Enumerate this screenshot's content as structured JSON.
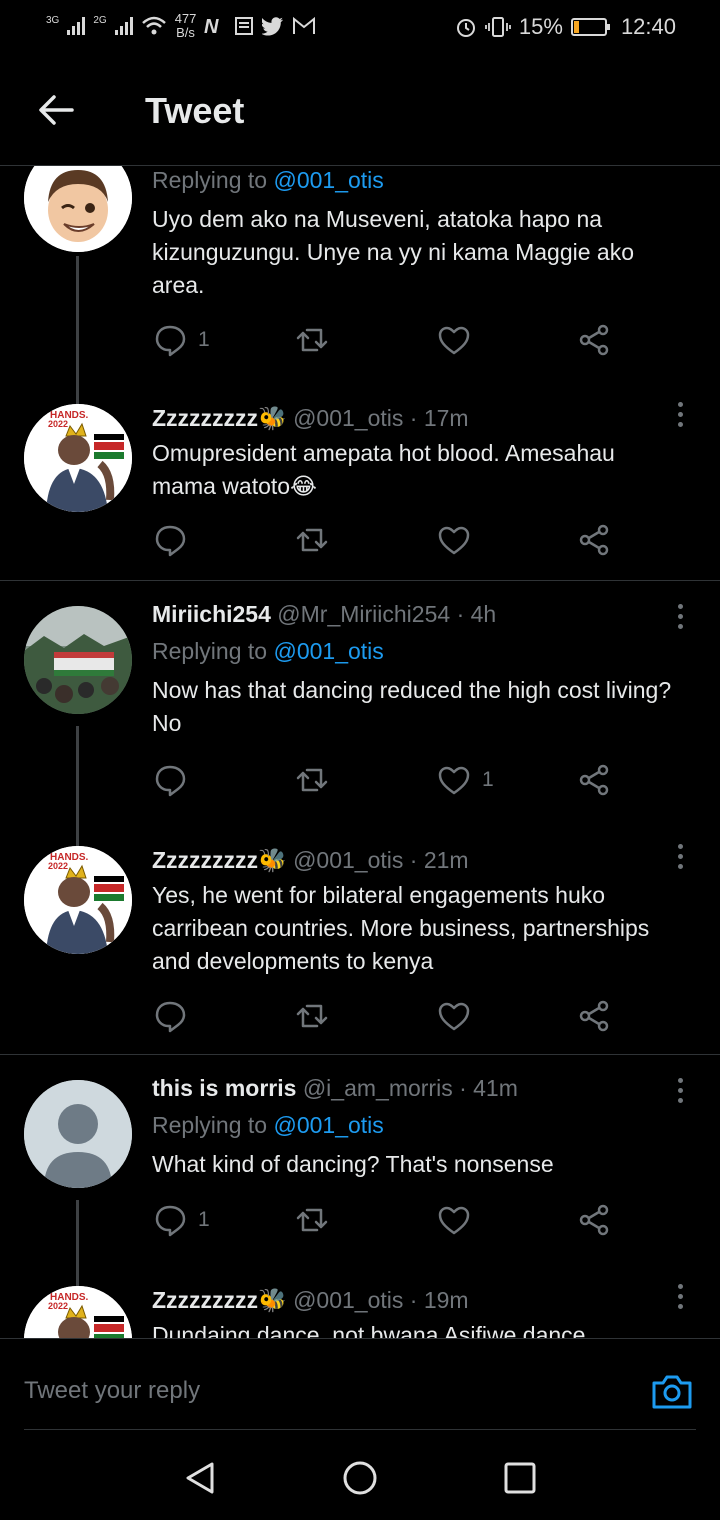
{
  "status": {
    "net1": "3G",
    "net2": "2G",
    "speed_value": "477",
    "speed_unit": "B/s",
    "battery_pct": "15%",
    "battery_level": 0.15,
    "time": "12:40"
  },
  "header": {
    "title": "Tweet"
  },
  "tweets": [
    {
      "name": "",
      "handle": "",
      "time": "",
      "replying_label": "Replying to",
      "replying_handle": "@001_otis",
      "content": "Uyo dem ako na Museveni, atatoka hapo na kizunguzungu. Unye na yy ni kama Maggie ako area.",
      "reply_count": "1",
      "like_count": ""
    },
    {
      "name": "Zzzzzzzzz🐝",
      "handle": "@001_otis",
      "time": "· 17m",
      "content": "Omupresident amepata hot blood. Amesahau mama watoto😂",
      "reply_count": "",
      "like_count": ""
    },
    {
      "name": "Miriichi254",
      "handle": "@Mr_Miriichi254",
      "time": "· 4h",
      "replying_label": "Replying to",
      "replying_handle": "@001_otis",
      "content": "Now has that dancing reduced the high cost living? No",
      "reply_count": "",
      "like_count": "1"
    },
    {
      "name": "Zzzzzzzzz🐝",
      "handle": "@001_otis",
      "time": "· 21m",
      "content": "Yes, he went for bilateral engagements huko carribean countries. More business, partnerships and developments to kenya",
      "reply_count": "",
      "like_count": ""
    },
    {
      "name": "this is morris",
      "handle": "@i_am_morris",
      "time": "· 41m",
      "replying_label": "Replying to",
      "replying_handle": "@001_otis",
      "content": "What kind of dancing? That's nonsense",
      "reply_count": "1",
      "like_count": ""
    },
    {
      "name": "Zzzzzzzzz🐝",
      "handle": "@001_otis",
      "time": "· 19m",
      "content": "Dundaing dance, not bwana Asifiwe dance",
      "reply_count": "",
      "like_count": ""
    }
  ],
  "avatar_text": {
    "hands": "HANDS.",
    "year": "2022"
  },
  "reply_bar": {
    "placeholder": "Tweet your reply"
  },
  "icons": {
    "back": "arrow-left-icon",
    "more": "more-vertical-icon",
    "reply": "comment-icon",
    "retweet": "retweet-icon",
    "like": "heart-icon",
    "share": "share-icon",
    "camera": "camera-icon"
  },
  "colors": {
    "accent": "#1d9bf0",
    "muted": "#71767b",
    "background": "#000000"
  }
}
